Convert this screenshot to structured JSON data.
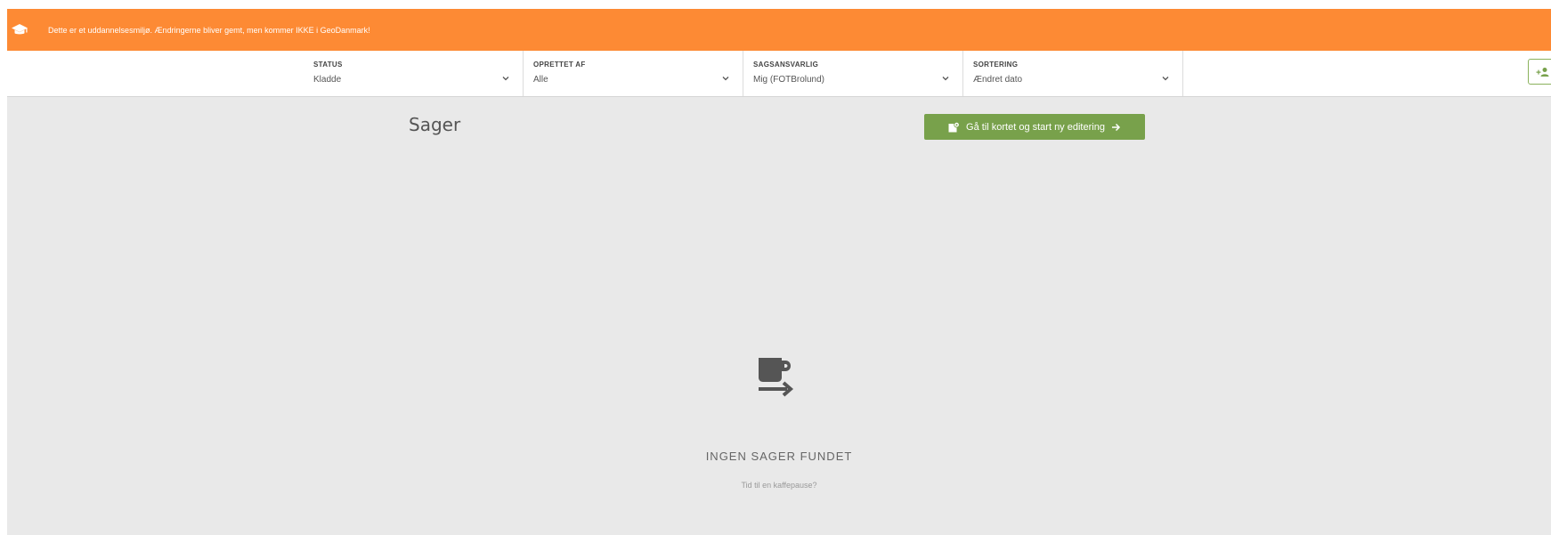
{
  "banner": {
    "message": "Dette er et uddannelsesmiljø. Ændringerne bliver gemt, men kommer IKKE i GeoDanmark!",
    "icon": "graduation-cap-icon",
    "color": "#fd8a34"
  },
  "filters": [
    {
      "label": "STATUS",
      "value": "Kladde"
    },
    {
      "label": "OPRETTET AF",
      "value": "Alle"
    },
    {
      "label": "SAGSANSVARLIG",
      "value": "Mig (FOTBrolund)"
    },
    {
      "label": "SORTERING",
      "value": "Ændret dato"
    }
  ],
  "main": {
    "title": "Sager",
    "go_button": {
      "label": "Gå til kortet og start ny editering",
      "color": "#78a14b"
    },
    "empty_state": {
      "icon": "coffee-cup-icon",
      "title": "INGEN SAGER FUNDET",
      "subtitle": "Tid til en kaffepause?"
    }
  },
  "add_user_icon": "add-user-icon"
}
